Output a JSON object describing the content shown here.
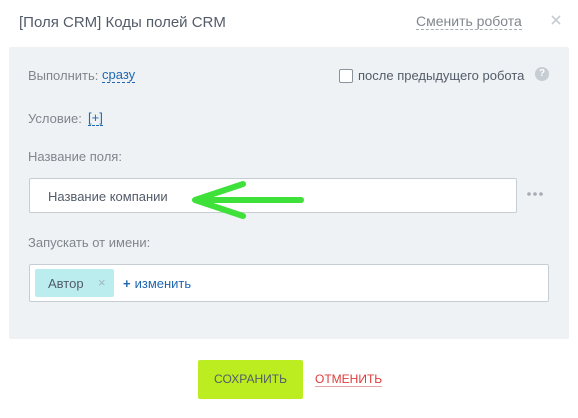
{
  "dialog": {
    "title": "[Поля CRM] Коды полей CRM",
    "change_robot": "Сменить робота"
  },
  "execute": {
    "label": "Выполнить:",
    "value": "сразу",
    "after_previous_label": "после предыдущего робота",
    "after_previous_checked": false,
    "help": "?"
  },
  "condition": {
    "label": "Условие:",
    "value": "[+]"
  },
  "field_name": {
    "label": "Название поля:",
    "value": "Название компании"
  },
  "run_as": {
    "label": "Запускать от имени:",
    "tag": "Автор",
    "tag_remove": "×",
    "change": "изменить",
    "change_prefix": "+"
  },
  "footer": {
    "save": "СОХРАНИТЬ",
    "cancel": "ОТМЕНИТЬ"
  },
  "colors": {
    "panel_bg": "#eef2f4",
    "save_bg": "#bbed21",
    "tag_bg": "#bcedee",
    "link": "#2067b0",
    "cancel": "#e03b3b",
    "arrow": "#3ee03a"
  },
  "icons": [
    "close-icon",
    "help-icon",
    "more-dots-icon",
    "remove-tag-icon",
    "annotation-arrow"
  ]
}
